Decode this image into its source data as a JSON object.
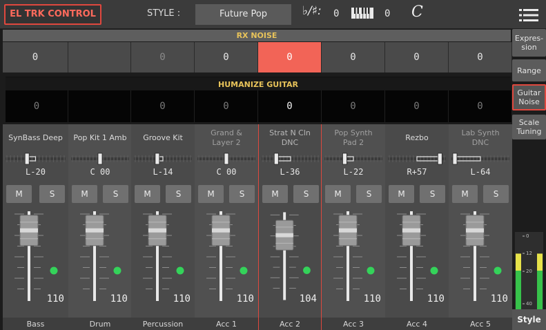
{
  "header": {
    "title": "EL TRK CONTROL",
    "style_label": "STYLE :",
    "style_name": "Future Pop",
    "key_sig_symbol": "♭/♯:",
    "key_sig_value": "0",
    "transpose_value": "0",
    "time_sig_symbol": "C"
  },
  "rx_noise": {
    "title": "RX NOISE",
    "values": [
      "0",
      "",
      "0",
      "0",
      "0",
      "0",
      "0",
      "0"
    ]
  },
  "humanize_guitar": {
    "title": "HUMANIZE GUITAR",
    "values": [
      "0",
      "",
      "0",
      "0",
      "0",
      "0",
      "0",
      "0"
    ]
  },
  "channels": [
    {
      "name": "SynBass Deep",
      "pan": "L-20",
      "pan_pos": -0.16,
      "volume": "110",
      "label": "Bass",
      "mute": "M",
      "solo": "S"
    },
    {
      "name": "Pop Kit 1 Amb",
      "pan": "C 00",
      "pan_pos": 0,
      "volume": "110",
      "label": "Drum",
      "mute": "M",
      "solo": "S"
    },
    {
      "name": "Groove Kit",
      "pan": "L-14",
      "pan_pos": -0.11,
      "volume": "110",
      "label": "Percussion",
      "mute": "M",
      "solo": "S"
    },
    {
      "name": "Grand &\nLayer 2",
      "pan": "C 00",
      "pan_pos": 0,
      "volume": "110",
      "label": "Acc 1",
      "mute": "M",
      "solo": "S"
    },
    {
      "name": "Strat N Cln\nDNC",
      "pan": "L-36",
      "pan_pos": -0.28,
      "volume": "104",
      "label": "Acc 2",
      "mute": "M",
      "solo": "S"
    },
    {
      "name": "Pop Synth\nPad 2",
      "pan": "L-22",
      "pan_pos": -0.17,
      "volume": "110",
      "label": "Acc 3",
      "mute": "M",
      "solo": "S"
    },
    {
      "name": "Rezbo",
      "pan": "R+57",
      "pan_pos": 0.45,
      "volume": "110",
      "label": "Acc 4",
      "mute": "M",
      "solo": "S"
    },
    {
      "name": "Lab Synth\nDNC",
      "pan": "L-64",
      "pan_pos": -0.5,
      "volume": "110",
      "label": "Acc 5",
      "mute": "M",
      "solo": "S"
    }
  ],
  "side_tabs": [
    "Expres-\nsion",
    "Range",
    "Guitar\nNoise",
    "Scale\nTuning"
  ],
  "style_tab": "Style",
  "meter_marks": [
    "0",
    "12",
    "20",
    "40"
  ],
  "meter_levels": [
    0.72,
    0.72
  ],
  "colors": {
    "accent": "#e0483e",
    "selected_cell": "#f26457",
    "section_title": "#e8c35a",
    "led": "#34d35a",
    "meter_green": "#37c24a",
    "meter_yellow": "#e6e24a"
  },
  "icons": {
    "menu": "hamburger-menu-icon",
    "keyboard": "keyboard-icon"
  }
}
